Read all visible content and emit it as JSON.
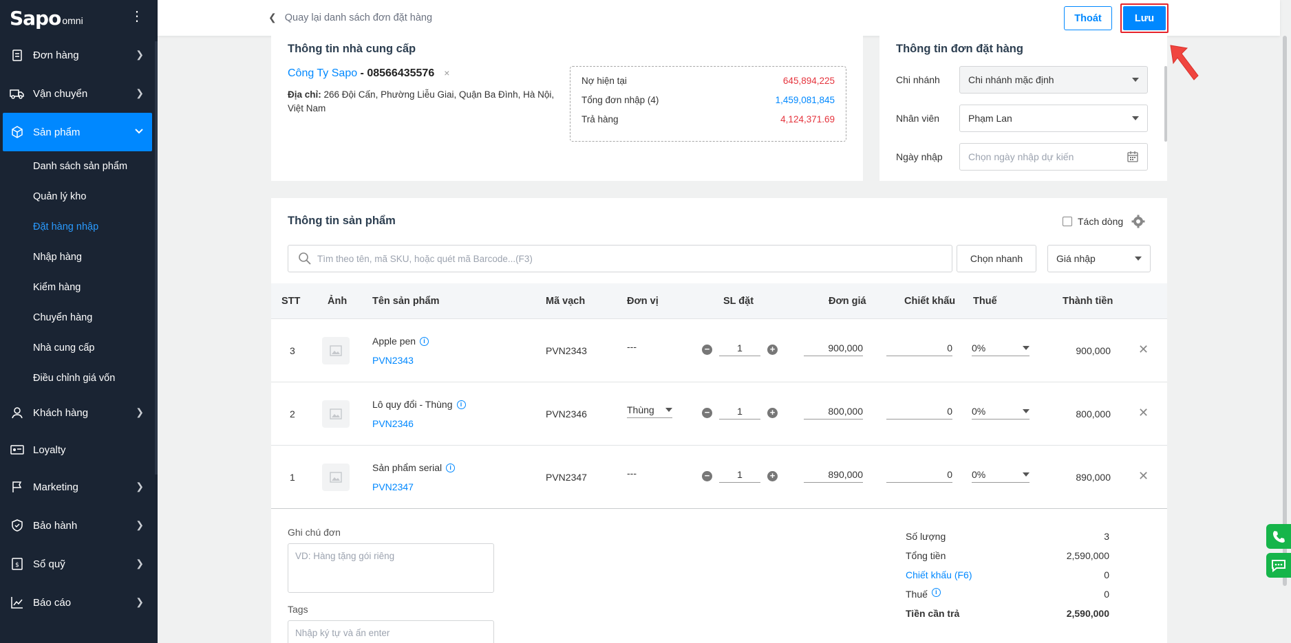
{
  "sidebar": {
    "logo_main": "Sapo",
    "logo_sub": "omni",
    "items": [
      {
        "label": "Đơn hàng"
      },
      {
        "label": "Vận chuyển"
      },
      {
        "label": "Sản phẩm"
      },
      {
        "label": "Khách hàng"
      },
      {
        "label": "Loyalty"
      },
      {
        "label": "Marketing"
      },
      {
        "label": "Bảo hành"
      },
      {
        "label": "Sổ quỹ"
      },
      {
        "label": "Báo cáo"
      }
    ],
    "sub_items": [
      {
        "label": "Danh sách sản phẩm"
      },
      {
        "label": "Quản lý kho"
      },
      {
        "label": "Đặt hàng nhập"
      },
      {
        "label": "Nhập hàng"
      },
      {
        "label": "Kiểm hàng"
      },
      {
        "label": "Chuyển hàng"
      },
      {
        "label": "Nhà cung cấp"
      },
      {
        "label": "Điều chỉnh giá vốn"
      }
    ]
  },
  "topbar": {
    "back_label": "Quay lại danh sách đơn đặt hàng",
    "exit_label": "Thoát",
    "save_label": "Lưu"
  },
  "supplier": {
    "title": "Thông tin nhà cung cấp",
    "name": "Công Ty Sapo",
    "phone": " - 08566435576",
    "remove": "×",
    "address_label": "Địa chỉ:",
    "address": " 266 Đội Cấn, Phường Liễu Giai, Quận Ba Đình, Hà Nội, Việt Nam",
    "debt": {
      "current_label": "Nợ hiện tại",
      "current_value": "645,894,225",
      "total_label": "Tổng đơn nhập (4)",
      "total_value": "1,459,081,845",
      "return_label": "Trả hàng",
      "return_value": "4,124,371.69"
    }
  },
  "order": {
    "title": "Thông tin đơn đặt hàng",
    "branch_label": "Chi nhánh",
    "branch_value": "Chi nhánh mặc định",
    "staff_label": "Nhân viên",
    "staff_value": "Phạm Lan",
    "date_label": "Ngày nhập",
    "date_placeholder": "Chọn ngày nhập dự kiến"
  },
  "products": {
    "title": "Thông tin sản phẩm",
    "split_label": "Tách dòng",
    "search_placeholder": "Tìm theo tên, mã SKU, hoặc quét mã Barcode...(F3)",
    "quick_label": "Chọn nhanh",
    "price_type": "Giá nhập",
    "columns": {
      "stt": "STT",
      "image": "Ảnh",
      "name": "Tên sản phẩm",
      "barcode": "Mã vạch",
      "unit": "Đơn vị",
      "qty": "SL đặt",
      "price": "Đơn giá",
      "discount": "Chiết khấu",
      "tax": "Thuế",
      "total": "Thành tiền"
    },
    "rows": [
      {
        "stt": "3",
        "name": "Apple pen",
        "sku": "PVN2343",
        "barcode": "PVN2343",
        "unit": "---",
        "qty": "1",
        "price": "900,000",
        "discount": "0",
        "tax": "0%",
        "total": "900,000"
      },
      {
        "stt": "2",
        "name": "Lô quy đổi - Thùng",
        "sku": "PVN2346",
        "barcode": "PVN2346",
        "unit": "Thùng",
        "qty": "1",
        "price": "800,000",
        "discount": "0",
        "tax": "0%",
        "total": "800,000"
      },
      {
        "stt": "1",
        "name": "Sản phẩm serial",
        "sku": "PVN2347",
        "barcode": "PVN2347",
        "unit": "---",
        "qty": "1",
        "price": "890,000",
        "discount": "0",
        "tax": "0%",
        "total": "890,000"
      }
    ]
  },
  "footer": {
    "note_label": "Ghi chú đơn",
    "note_placeholder": "VD: Hàng tặng gói riêng",
    "tags_label": "Tags",
    "tags_placeholder": "Nhập ký tự và ấn enter",
    "summary": {
      "qty_label": "Số lượng",
      "qty_value": "3",
      "total_label": "Tổng tiền",
      "total_value": "2,590,000",
      "discount_label": "Chiết khấu (F6)",
      "discount_value": "0",
      "tax_label": "Thuế",
      "tax_value": "0",
      "pay_label": "Tiền cần trả",
      "pay_value": "2,590,000"
    }
  },
  "colors": {
    "accent": "#0088ff",
    "sidebar_bg": "#1a2433",
    "negative": "#e5343d",
    "highlight_border": "#e5232b"
  }
}
